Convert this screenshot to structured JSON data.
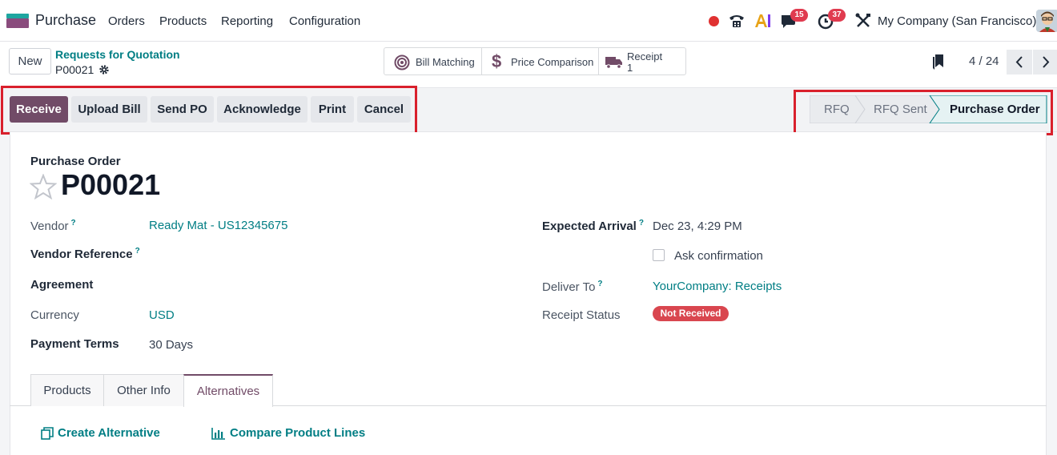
{
  "navbar": {
    "app_name": "Purchase",
    "menu": [
      "Orders",
      "Products",
      "Reporting",
      "Configuration"
    ],
    "messages_count": "15",
    "activities_count": "37",
    "company": "My Company (San Francisco)"
  },
  "control": {
    "new_label": "New",
    "breadcrumb": "Requests for Quotation",
    "record_name": "P00021",
    "smart_buttons": {
      "bill_matching": "Bill Matching",
      "price_comparison": "Price Comparison",
      "receipt_label": "Receipt",
      "receipt_count": "1"
    },
    "pager": "4 / 24"
  },
  "statusbar": {
    "actions": [
      "Receive",
      "Upload Bill",
      "Send PO",
      "Acknowledge",
      "Print",
      "Cancel"
    ],
    "stages": [
      "RFQ",
      "RFQ Sent",
      "Purchase Order"
    ],
    "active_stage": "Purchase Order"
  },
  "form": {
    "doc_type": "Purchase Order",
    "title": "P00021",
    "left": {
      "vendor_label": "Vendor",
      "vendor_value": "Ready Mat - US12345675",
      "vendor_ref_label": "Vendor Reference",
      "agreement_label": "Agreement",
      "currency_label": "Currency",
      "currency_value": "USD",
      "payment_terms_label": "Payment Terms",
      "payment_terms_value": "30 Days"
    },
    "right": {
      "expected_arrival_label": "Expected Arrival",
      "expected_arrival_value": "Dec 23, 4:29 PM",
      "ask_confirmation_label": "Ask confirmation",
      "deliver_to_label": "Deliver To",
      "deliver_to_value": "YourCompany: Receipts",
      "receipt_status_label": "Receipt Status",
      "receipt_status_value": "Not Received"
    },
    "help_mark": "?"
  },
  "tabs": [
    "Products",
    "Other Info",
    "Alternatives"
  ],
  "active_tab": "Alternatives",
  "alternatives": {
    "create": "Create Alternative",
    "compare": "Compare Product Lines"
  },
  "colors": {
    "brand": "#714b67",
    "link": "#017e84",
    "highlight": "#d9202c",
    "danger": "#d9464f"
  }
}
